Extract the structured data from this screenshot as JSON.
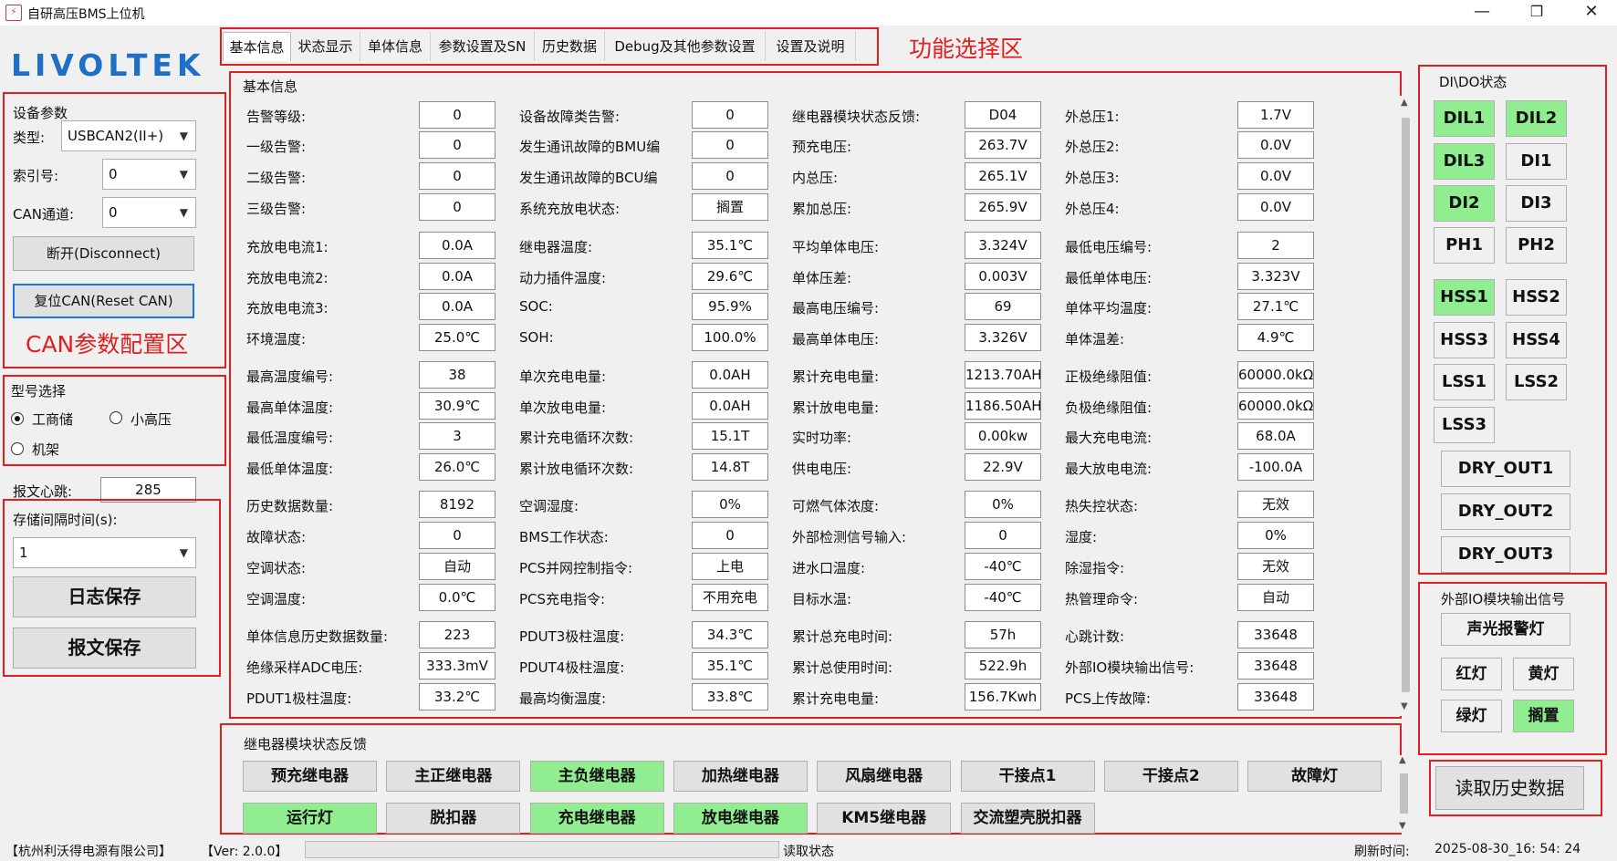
{
  "window": {
    "title": "自研高压BMS上位机",
    "minimize": "—",
    "restore": "❐",
    "close": "✕"
  },
  "logo": "LIVOLTEK",
  "annotations": {
    "function_area": "功能选择区",
    "can_config_area": "CAN参数配置区"
  },
  "device": {
    "group_title": "设备参数",
    "type_label": "类型:",
    "type_value": "USBCAN2(II+)",
    "index_label": "索引号:",
    "index_value": "0",
    "channel_label": "CAN通道:",
    "channel_value": "0",
    "disconnect_label": "断开(Disconnect)",
    "reset_label": "复位CAN(Reset CAN)"
  },
  "model": {
    "group_title": "型号选择",
    "options": [
      "工商储",
      "小高压",
      "机架"
    ],
    "selected": "工商储"
  },
  "heartbeat": {
    "label": "报文心跳:",
    "value": "285"
  },
  "storage": {
    "interval_label": "存储间隔时间(s):",
    "interval_value": "1",
    "log_save": "日志保存",
    "msg_save": "报文保存"
  },
  "tabs": [
    "基本信息",
    "状态显示",
    "单体信息",
    "参数设置及SN",
    "历史数据",
    "Debug及其他参数设置",
    "设置及说明"
  ],
  "basic": {
    "group_title": "基本信息",
    "rows": [
      [
        [
          "告警等级:",
          "0"
        ],
        [
          "设备故障类告警:",
          "0"
        ],
        [
          "继电器模块状态反馈:",
          "D04"
        ],
        [
          "外总压1:",
          "1.7V"
        ]
      ],
      [
        [
          "一级告警:",
          "0"
        ],
        [
          "发生通讯故障的BMU编",
          "0"
        ],
        [
          "预充电压:",
          "263.7V"
        ],
        [
          "外总压2:",
          "0.0V"
        ]
      ],
      [
        [
          "二级告警:",
          "0"
        ],
        [
          "发生通讯故障的BCU编",
          "0"
        ],
        [
          "内总压:",
          "265.1V"
        ],
        [
          "外总压3:",
          "0.0V"
        ]
      ],
      [
        [
          "三级告警:",
          "0"
        ],
        [
          "系统充放电状态:",
          "搁置"
        ],
        [
          "累加总压:",
          "265.9V"
        ],
        [
          "外总压4:",
          "0.0V"
        ]
      ],
      [
        [
          "充放电电流1:",
          "0.0A"
        ],
        [
          "继电器温度:",
          "35.1℃"
        ],
        [
          "平均单体电压:",
          "3.324V"
        ],
        [
          "最低电压编号:",
          "2"
        ]
      ],
      [
        [
          "充放电电流2:",
          "0.0A"
        ],
        [
          "动力插件温度:",
          "29.6℃"
        ],
        [
          "单体压差:",
          "0.003V"
        ],
        [
          "最低单体电压:",
          "3.323V"
        ]
      ],
      [
        [
          "充放电电流3:",
          "0.0A"
        ],
        [
          "SOC:",
          "95.9%"
        ],
        [
          "最高电压编号:",
          "69"
        ],
        [
          "单体平均温度:",
          "27.1℃"
        ]
      ],
      [
        [
          "环境温度:",
          "25.0℃"
        ],
        [
          "SOH:",
          "100.0%"
        ],
        [
          "最高单体电压:",
          "3.326V"
        ],
        [
          "单体温差:",
          "4.9℃"
        ]
      ],
      [
        [
          "最高温度编号:",
          "38"
        ],
        [
          "单次充电电量:",
          "0.0AH"
        ],
        [
          "累计充电电量:",
          "1213.70AH"
        ],
        [
          "正极绝缘阻值:",
          "60000.0kΩ"
        ]
      ],
      [
        [
          "最高单体温度:",
          "30.9℃"
        ],
        [
          "单次放电电量:",
          "0.0AH"
        ],
        [
          "累计放电电量:",
          "1186.50AH"
        ],
        [
          "负极绝缘阻值:",
          "60000.0kΩ"
        ]
      ],
      [
        [
          "最低温度编号:",
          "3"
        ],
        [
          "累计充电循环次数:",
          "15.1T"
        ],
        [
          "实时功率:",
          "0.00kw"
        ],
        [
          "最大充电电流:",
          "68.0A"
        ]
      ],
      [
        [
          "最低单体温度:",
          "26.0℃"
        ],
        [
          "累计放电循环次数:",
          "14.8T"
        ],
        [
          "供电电压:",
          "22.9V"
        ],
        [
          "最大放电电流:",
          "-100.0A"
        ]
      ],
      [
        [
          "历史数据数量:",
          "8192"
        ],
        [
          "空调湿度:",
          "0%"
        ],
        [
          "可燃气体浓度:",
          "0%"
        ],
        [
          "热失控状态:",
          "无效"
        ]
      ],
      [
        [
          "故障状态:",
          "0"
        ],
        [
          "BMS工作状态:",
          "0"
        ],
        [
          "外部检测信号输入:",
          "0"
        ],
        [
          "湿度:",
          "0%"
        ]
      ],
      [
        [
          "空调状态:",
          "自动"
        ],
        [
          "PCS并网控制指令:",
          "上电"
        ],
        [
          "进水口温度:",
          "-40℃"
        ],
        [
          "除湿指令:",
          "无效"
        ]
      ],
      [
        [
          "空调温度:",
          "0.0℃"
        ],
        [
          "PCS充电指令:",
          "不用充电"
        ],
        [
          "目标水温:",
          "-40℃"
        ],
        [
          "热管理命令:",
          "自动"
        ]
      ],
      [
        [
          "单体信息历史数据数量:",
          "223"
        ],
        [
          "PDUT3极柱温度:",
          "34.3℃"
        ],
        [
          "累计总充电时间:",
          "57h"
        ],
        [
          "心跳计数:",
          "33648"
        ]
      ],
      [
        [
          "绝缘采样ADC电压:",
          "333.3mV"
        ],
        [
          "PDUT4极柱温度:",
          "35.1℃"
        ],
        [
          "累计总使用时间:",
          "522.9h"
        ],
        [
          "外部IO模块输出信号:",
          "33648"
        ]
      ],
      [
        [
          "PDUT1极柱温度:",
          "33.2℃"
        ],
        [
          "最高均衡温度:",
          "33.8℃"
        ],
        [
          "累计充电电量:",
          "156.7Kwh"
        ],
        [
          "PCS上传故障:",
          "33648"
        ]
      ]
    ]
  },
  "dido": {
    "group_title": "DI\\DO状态",
    "items": [
      {
        "label": "DIL1",
        "on": true
      },
      {
        "label": "DIL2",
        "on": true
      },
      {
        "label": "DIL3",
        "on": true
      },
      {
        "label": "DI1",
        "on": false
      },
      {
        "label": "DI2",
        "on": true
      },
      {
        "label": "DI3",
        "on": false
      },
      {
        "label": "PH1",
        "on": false
      },
      {
        "label": "PH2",
        "on": false
      },
      {
        "label": "HSS1",
        "on": true
      },
      {
        "label": "HSS2",
        "on": false
      },
      {
        "label": "HSS3",
        "on": false
      },
      {
        "label": "HSS4",
        "on": false
      },
      {
        "label": "LSS1",
        "on": false
      },
      {
        "label": "LSS2",
        "on": false
      },
      {
        "label": "LSS3",
        "on": false
      }
    ],
    "dry": [
      "DRY_OUT1",
      "DRY_OUT2",
      "DRY_OUT3"
    ]
  },
  "extio": {
    "group_title": "外部IO模块输出信号",
    "items": [
      {
        "label": "声光报警灯",
        "on": false
      },
      {
        "label": "红灯",
        "on": false
      },
      {
        "label": "黄灯",
        "on": false
      },
      {
        "label": "绿灯",
        "on": false
      },
      {
        "label": "搁置",
        "on": true
      }
    ]
  },
  "read_history": "读取历史数据",
  "relays": {
    "group_title": "继电器模块状态反馈",
    "items": [
      {
        "label": "预充继电器",
        "on": false
      },
      {
        "label": "主正继电器",
        "on": false
      },
      {
        "label": "主负继电器",
        "on": true
      },
      {
        "label": "加热继电器",
        "on": false
      },
      {
        "label": "风扇继电器",
        "on": false
      },
      {
        "label": "干接点1",
        "on": false
      },
      {
        "label": "干接点2",
        "on": false
      },
      {
        "label": "故障灯",
        "on": false
      },
      {
        "label": "运行灯",
        "on": true
      },
      {
        "label": "脱扣器",
        "on": false
      },
      {
        "label": "充电继电器",
        "on": true
      },
      {
        "label": "放电继电器",
        "on": true
      },
      {
        "label": "KM5继电器",
        "on": false
      },
      {
        "label": "交流塑壳脱扣器",
        "on": false
      }
    ]
  },
  "statusbar": {
    "company": "【杭州利沃得电源有限公司】",
    "version": "【Ver: 2.0.0】",
    "read_status": "读取状态",
    "refresh_label": "刷新时间:",
    "refresh_time": "2025-08-30_16: 54: 24"
  },
  "colors": {
    "on": "#90ee90",
    "annotation": "#e02020",
    "logo": "#1e6fc8"
  }
}
